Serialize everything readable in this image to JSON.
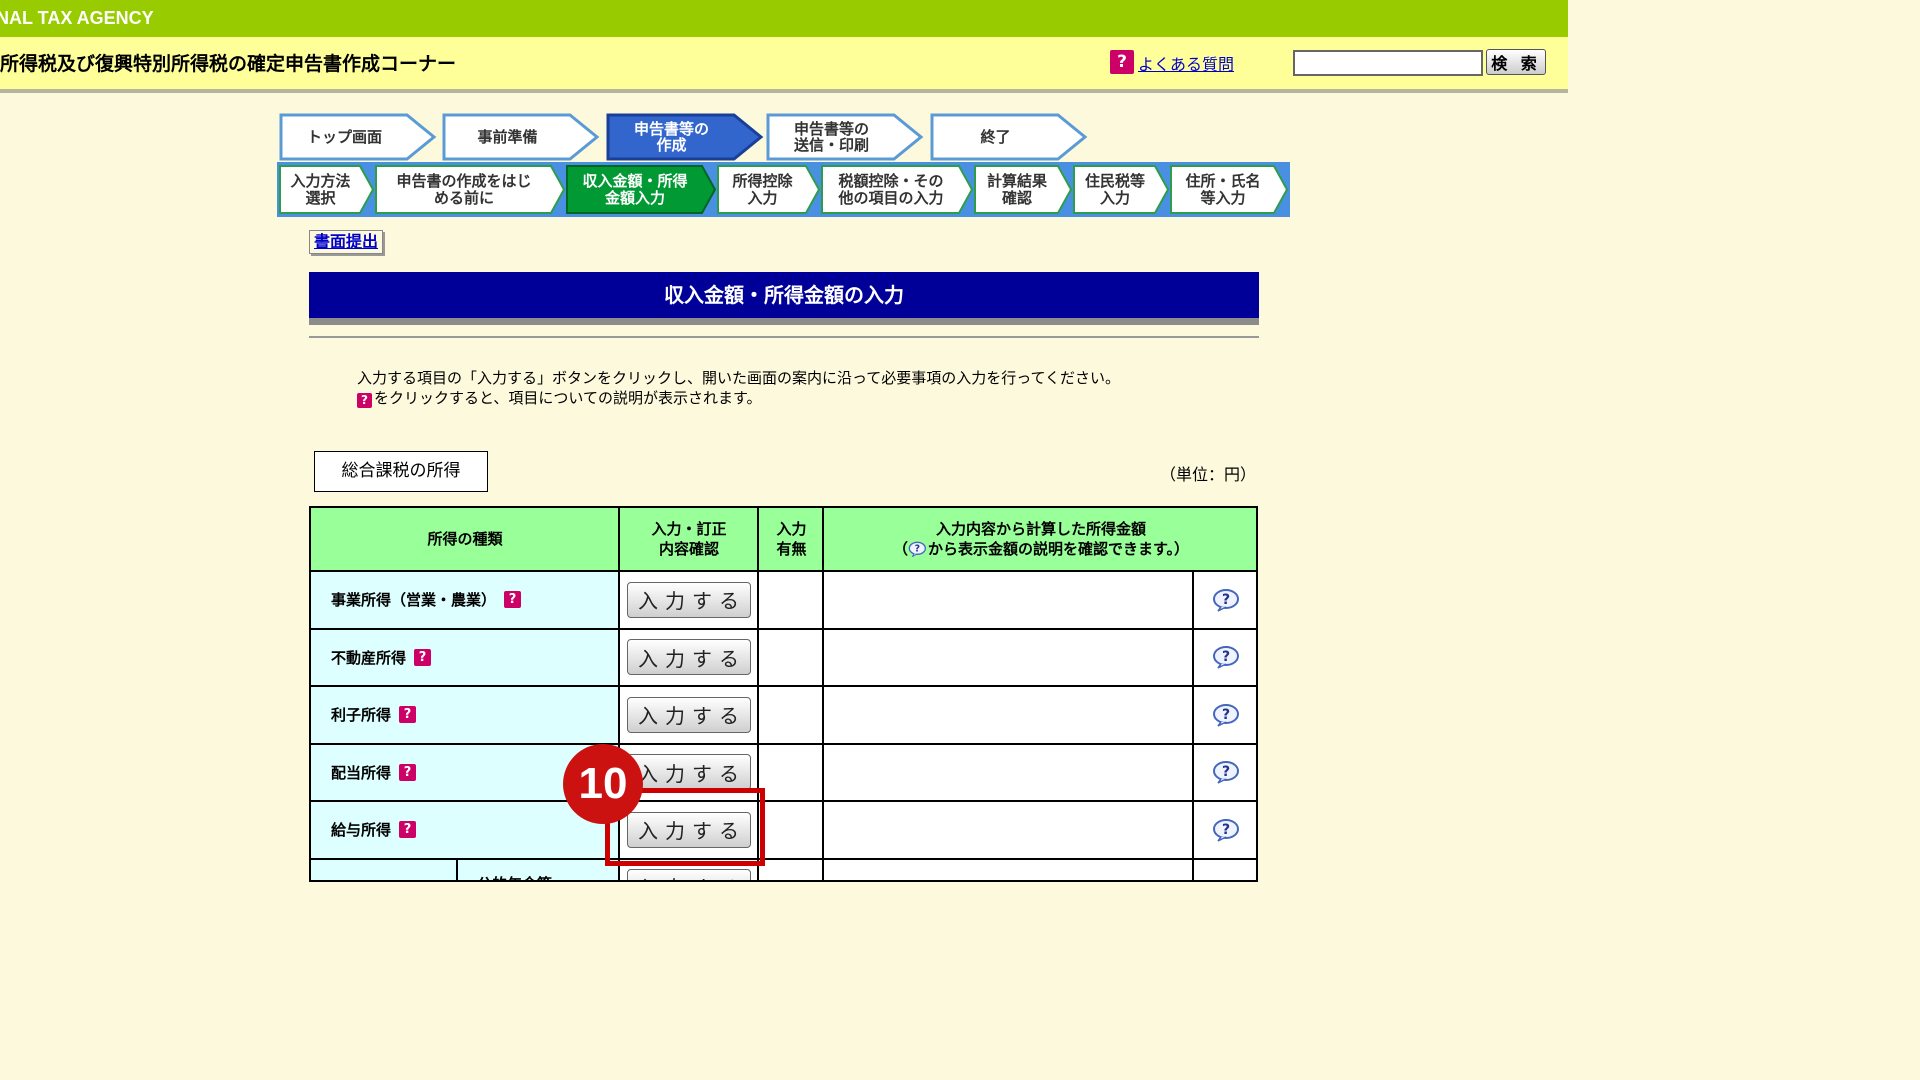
{
  "agency_banner": "NAL TAX AGENCY",
  "header": {
    "title": "所得税及び復興特別所得税の確定申告書作成コーナー",
    "faq_icon": "?",
    "faq_link": "よくある質問",
    "search_placeholder": "",
    "search_button": "検 索"
  },
  "main_steps": [
    {
      "label": "トップ画面",
      "active": false
    },
    {
      "label": "事前準備",
      "active": false
    },
    {
      "label": "申告書等の\n作成",
      "active": true
    },
    {
      "label": "申告書等の\n送信・印刷",
      "active": false
    },
    {
      "label": "終了",
      "active": false
    }
  ],
  "sub_steps": [
    {
      "label": "入力方法\n選択",
      "active": false
    },
    {
      "label": "申告書の作成をはじ\nめる前に",
      "active": false
    },
    {
      "label": "収入金額・所得\n金額入力",
      "active": true
    },
    {
      "label": "所得控除\n入力",
      "active": false
    },
    {
      "label": "税額控除・その\n他の項目の入力",
      "active": false
    },
    {
      "label": "計算結果\n確認",
      "active": false
    },
    {
      "label": "住民税等\n入力",
      "active": false
    },
    {
      "label": "住所・氏名\n等入力",
      "active": false
    }
  ],
  "doc_submit": "書面提出",
  "page_title": "収入金額・所得金額の入力",
  "instructions": {
    "line1": "入力する項目の「入力する」ボタンをクリックし、開いた画面の案内に沿って必要事項の入力を行ってください。",
    "icon": "?",
    "line2": "をクリックすると、項目についての説明が表示されます。"
  },
  "section_label": "総合課税の所得",
  "unit_label": "（単位：円）",
  "table": {
    "headers": {
      "type": "所得の種類",
      "confirm": "入力・訂正\n内容確認",
      "presence": "入力\n有無",
      "calc_line1": "入力内容から計算した所得金額",
      "calc_line2_open": "（",
      "calc_line2_rest": "から表示金額の説明を確認できます。）"
    },
    "rows": [
      {
        "label": "事業所得（営業・農業）",
        "help": "?",
        "button": "入力する",
        "presence": "",
        "amount": ""
      },
      {
        "label": "不動産所得",
        "help": "?",
        "button": "入力する",
        "presence": "",
        "amount": ""
      },
      {
        "label": "利子所得",
        "help": "?",
        "button": "入力する",
        "presence": "",
        "amount": ""
      },
      {
        "label": "配当所得",
        "help": "?",
        "button": "入力する",
        "presence": "",
        "amount": ""
      },
      {
        "label": "給与所得",
        "help": "?",
        "button": "入力する",
        "presence": "",
        "amount": ""
      }
    ],
    "partial_row": {
      "sub_label": "公的年金等",
      "button": "入力する"
    }
  },
  "annotation": {
    "step_number": "10"
  },
  "colors": {
    "banner_green": "#99cc00",
    "header_yellow": "#ffff99",
    "page_bg": "#fdf9dd",
    "title_navy": "#000099",
    "table_header": "#99ff99",
    "table_label": "#ddffff",
    "step_active_blue": "#3366cc",
    "substep_active_green": "#009933",
    "annotation_red": "#cc0000"
  }
}
